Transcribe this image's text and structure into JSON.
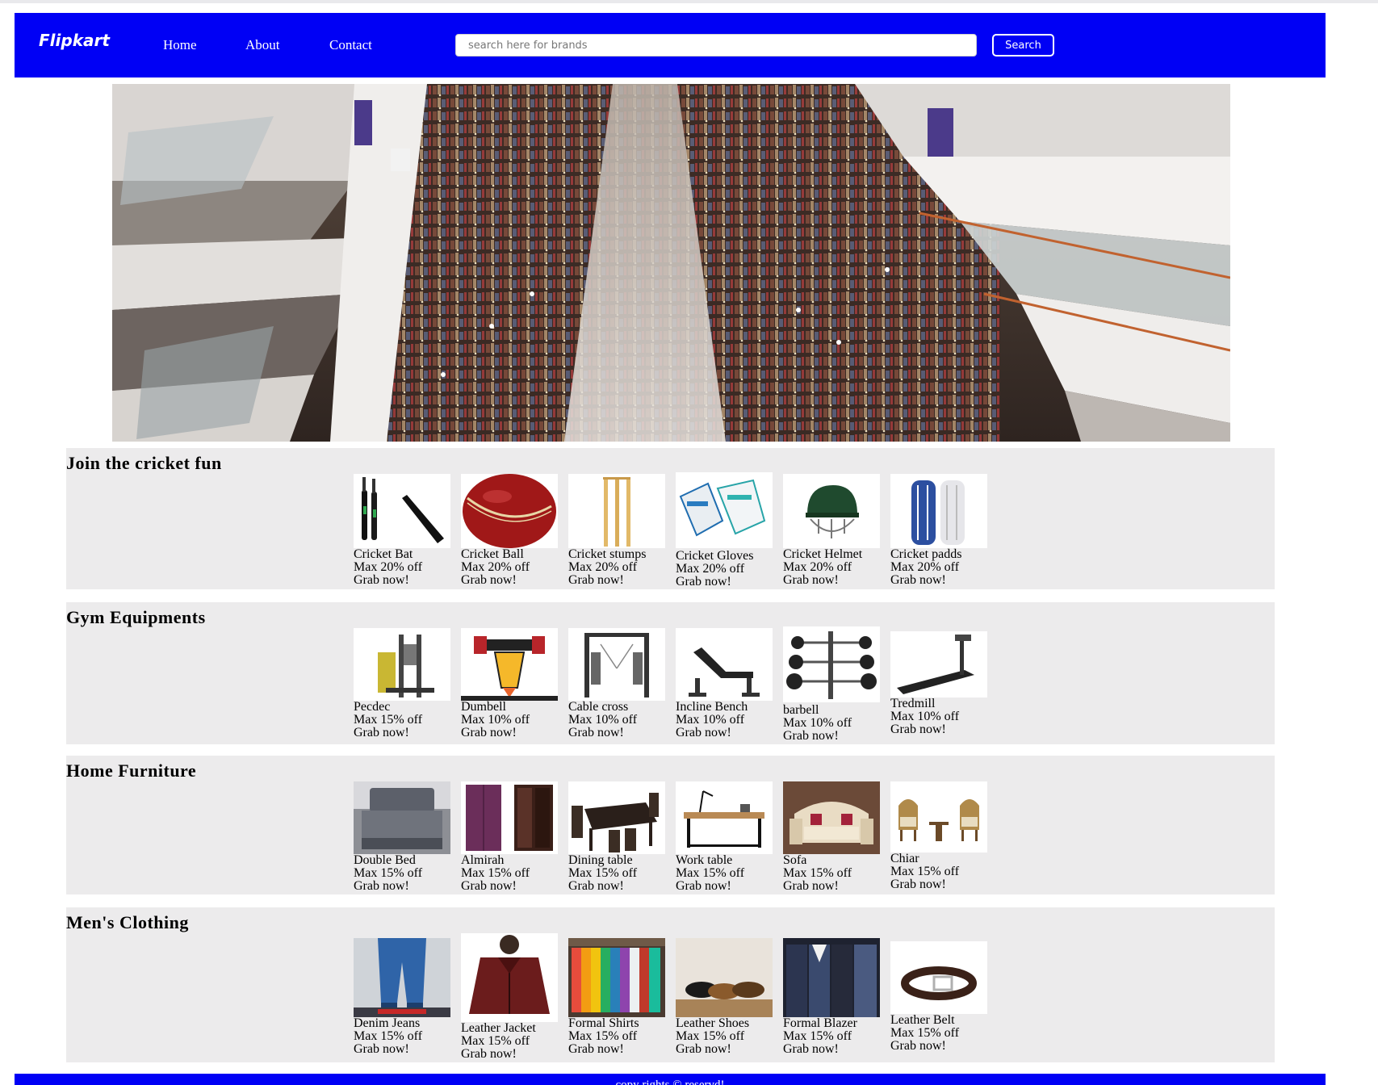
{
  "navbar": {
    "brand": "Flipkart",
    "links": [
      "Home",
      "About",
      "Contact"
    ],
    "search_placeholder": "search here for brands",
    "search_button": "Search"
  },
  "sections": [
    {
      "title": "Join the cricket fun",
      "items": [
        {
          "name": "Cricket Bat",
          "offer": "Max 20% off",
          "cta": "Grab now!"
        },
        {
          "name": "Cricket Ball",
          "offer": "Max 20% off",
          "cta": "Grab now!"
        },
        {
          "name": "Cricket stumps",
          "offer": "Max 20% off",
          "cta": "Grab now!"
        },
        {
          "name": "Cricket Gloves",
          "offer": "Max 20% off",
          "cta": "Grab now!"
        },
        {
          "name": "Cricket Helmet",
          "offer": "Max 20% off",
          "cta": "Grab now!"
        },
        {
          "name": "Cricket padds",
          "offer": "Max 20% off",
          "cta": "Grab now!"
        }
      ]
    },
    {
      "title": "Gym Equipments",
      "items": [
        {
          "name": "Pecdec",
          "offer": "Max 15% off",
          "cta": "Grab now!"
        },
        {
          "name": "Dumbell",
          "offer": "Max 10% off",
          "cta": "Grab now!"
        },
        {
          "name": "Cable cross",
          "offer": "Max 10% off",
          "cta": "Grab now!"
        },
        {
          "name": "Incline Bench",
          "offer": "Max 10% off",
          "cta": "Grab now!"
        },
        {
          "name": "barbell",
          "offer": "Max 10% off",
          "cta": "Grab now!"
        },
        {
          "name": "Tredmill",
          "offer": "Max 10% off",
          "cta": "Grab now!"
        }
      ]
    },
    {
      "title": "Home Furniture",
      "items": [
        {
          "name": "Double Bed",
          "offer": "Max 15% off",
          "cta": "Grab now!"
        },
        {
          "name": "Almirah",
          "offer": "Max 15% off",
          "cta": "Grab now!"
        },
        {
          "name": "Dining table",
          "offer": "Max 15% off",
          "cta": "Grab now!"
        },
        {
          "name": "Work table",
          "offer": "Max 15% off",
          "cta": "Grab now!"
        },
        {
          "name": "Sofa",
          "offer": "Max 15% off",
          "cta": "Grab now!"
        },
        {
          "name": "Chiar",
          "offer": "Max 15% off",
          "cta": "Grab now!"
        }
      ]
    },
    {
      "title": "Men's Clothing",
      "items": [
        {
          "name": "Denim Jeans",
          "offer": "Max 15% off",
          "cta": "Grab now!"
        },
        {
          "name": "Leather Jacket",
          "offer": "Max 15% off",
          "cta": "Grab now!"
        },
        {
          "name": "Formal Shirts",
          "offer": "Max 15% off",
          "cta": "Grab now!"
        },
        {
          "name": "Leather Shoes",
          "offer": "Max 15% off",
          "cta": "Grab now!"
        },
        {
          "name": "Formal Blazer",
          "offer": "Max 15% off",
          "cta": "Grab now!"
        },
        {
          "name": "Leather Belt",
          "offer": "Max 15% off",
          "cta": "Grab now!"
        }
      ]
    }
  ],
  "footer": {
    "text": "copy rights © reservd!"
  },
  "colors": {
    "navbar": "#0000f5",
    "section_bg": "#ecebec",
    "footer": "#0000f5"
  }
}
